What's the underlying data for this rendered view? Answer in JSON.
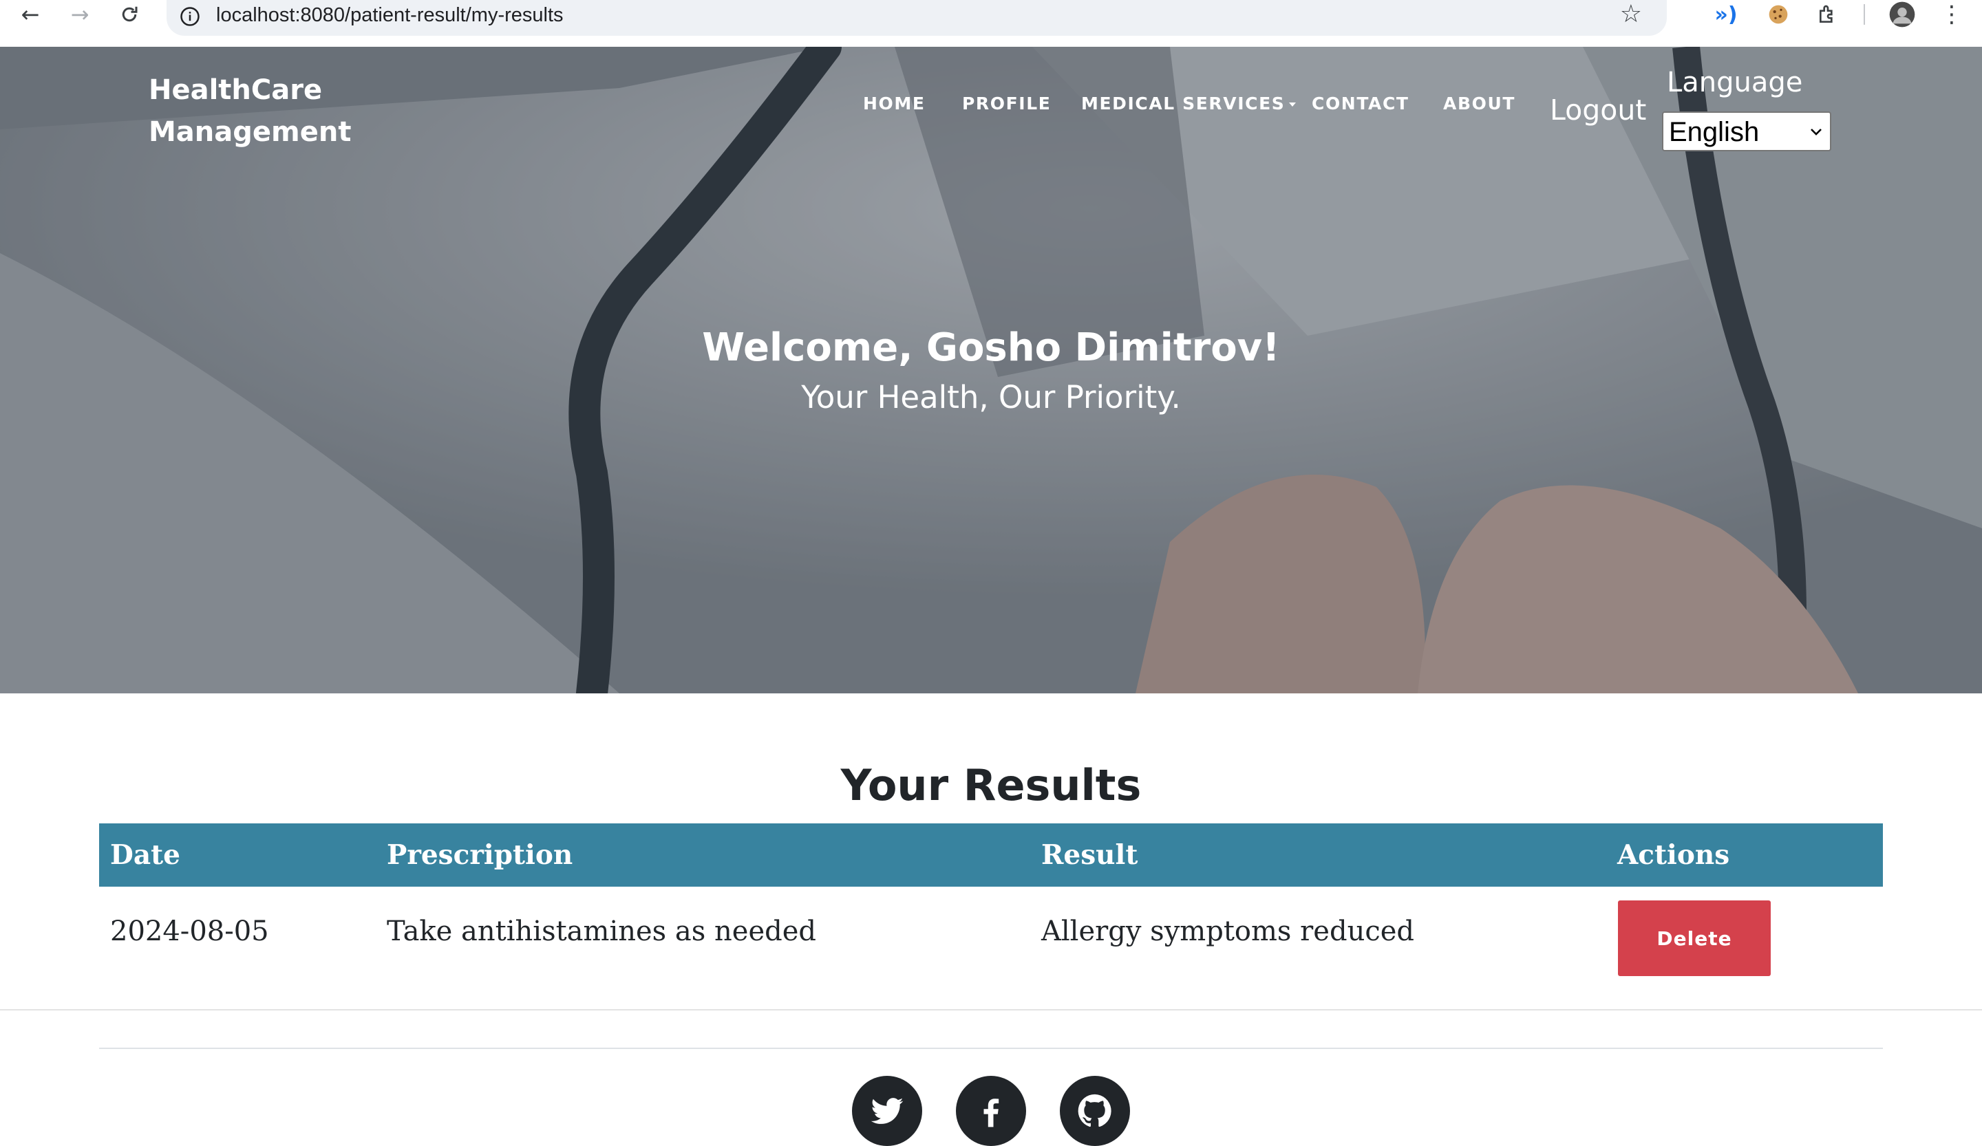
{
  "browser": {
    "url": "localhost:8080/patient-result/my-results",
    "icons": [
      "back-arrow-icon",
      "forward-arrow-icon",
      "reload-icon",
      "site-info-icon",
      "bookmark-star-icon",
      "extension-audio-icon",
      "cookie-extension-icon",
      "puzzle-extensions-icon",
      "profile-avatar",
      "more-menu-icon"
    ]
  },
  "header": {
    "brand": "HealthCare Management",
    "nav": [
      "HOME",
      "PROFILE",
      "MEDICAL SERVICES",
      "CONTACT",
      "ABOUT"
    ],
    "logout": "Logout",
    "language_label": "Language",
    "language_selected": "English"
  },
  "hero": {
    "welcome": "Welcome, Gosho Dimitrov!",
    "tagline": "Your Health, Our Priority."
  },
  "results": {
    "title": "Your Results",
    "columns": [
      "Date",
      "Prescription",
      "Result",
      "Actions"
    ],
    "rows": [
      {
        "date": "2024-08-05",
        "prescription": "Take antihistamines as needed",
        "result": "Allergy symptoms reduced",
        "action": "Delete"
      }
    ]
  },
  "footer": {
    "social_icons": [
      "twitter-icon",
      "facebook-icon",
      "github-icon"
    ]
  },
  "colors": {
    "table_header": "#38839f",
    "delete_button": "#d4414c",
    "text_dark": "#212529"
  }
}
